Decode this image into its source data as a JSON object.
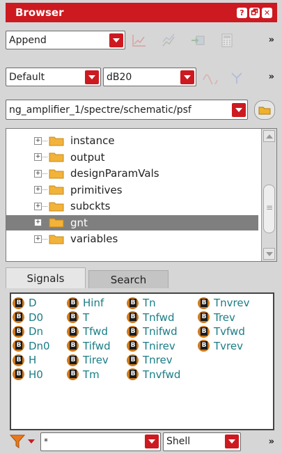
{
  "window": {
    "title": "Browser",
    "buttons": [
      "?",
      "🗗",
      "✕"
    ]
  },
  "toolbar1": {
    "mode_value": "Append",
    "more": "»"
  },
  "toolbar2": {
    "type_value": "Default",
    "unit_value": "dB20",
    "more": "»"
  },
  "path": {
    "value": "ng_amplifier_1/spectre/schematic/psf"
  },
  "tree": {
    "items": [
      {
        "label": "instance"
      },
      {
        "label": "output"
      },
      {
        "label": "designParamVals"
      },
      {
        "label": "primitives"
      },
      {
        "label": "subckts"
      },
      {
        "label": "gnt",
        "selected": true
      },
      {
        "label": "variables"
      }
    ]
  },
  "tabs": [
    {
      "label": "Signals"
    },
    {
      "label": "Search"
    }
  ],
  "signals": [
    [
      "D",
      "Hinf",
      "Tn",
      "Tnvrev"
    ],
    [
      "D0",
      "T",
      "Tnfwd",
      "Trev"
    ],
    [
      "Dn",
      "Tfwd",
      "Tnifwd",
      "Tvfwd"
    ],
    [
      "Dn0",
      "Tifwd",
      "Tnirev",
      "Tvrev"
    ],
    [
      "H",
      "Tirev",
      "Tnrev",
      ""
    ],
    [
      "H0",
      "Tm",
      "Tnvfwd",
      ""
    ]
  ],
  "bottombar": {
    "filter_value": "*",
    "shell_value": "Shell",
    "more": "»"
  },
  "colors": {
    "accent": "#cc1a20",
    "signal_text": "#1a7d86",
    "badge": "#cf7a1c"
  }
}
